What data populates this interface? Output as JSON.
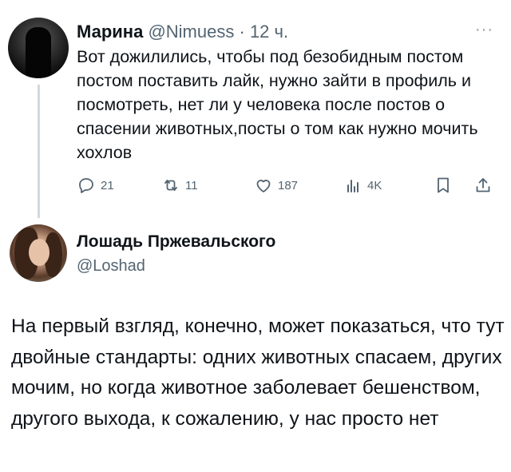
{
  "tweet1": {
    "author_name": "Марина",
    "author_handle": "@Nimuess",
    "time_separator": "·",
    "time": "12 ч.",
    "more_icon": "more-dots-icon",
    "text": "Вот дожилились, чтобы под безобидным постом постом поставить лайк, нужно зайти в профиль и посмотреть, нет ли у человека после постов о спасении животных,посты о том как нужно мочить хохлов",
    "actions": {
      "replies": "21",
      "retweets": "11",
      "likes": "187",
      "views": "4K"
    },
    "icons": [
      "reply-icon",
      "retweet-icon",
      "like-icon",
      "views-icon",
      "bookmark-icon",
      "share-icon"
    ]
  },
  "tweet2": {
    "author_name": "Лошадь Пржевальского",
    "author_handle": "@Loshad",
    "text": "На первый взгляд, конечно, может показаться, что тут двойные стандарты: одних животных спасаем, других мочим, но когда животное заболевает бешенством, другого выхода, к сожалению, у нас просто нет"
  },
  "colors": {
    "text": "#0f1419",
    "secondary": "#536471",
    "thread_line": "#cfd9de",
    "background": "#ffffff"
  }
}
